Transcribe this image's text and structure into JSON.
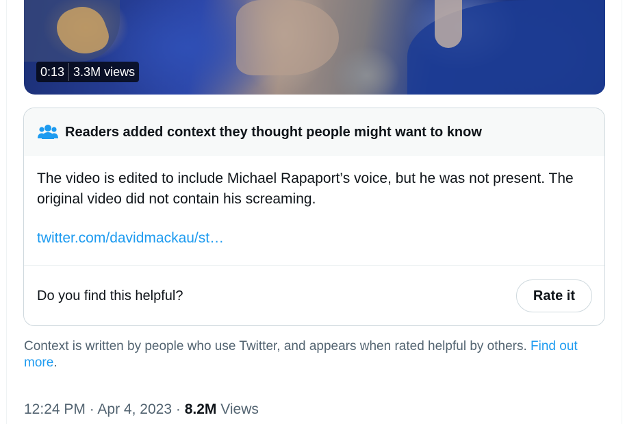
{
  "video": {
    "duration": "0:13",
    "views": "3.3M views"
  },
  "note": {
    "icon": "people-icon",
    "header": "Readers added context they thought people might want to know",
    "text": "The video is edited to include Michael Rapaport’s voice, but he was not present. The original video did not contain his screaming.",
    "link": "twitter.com/davidmackau/st…",
    "helpful_question": "Do you find this helpful?",
    "rate_button": "Rate it"
  },
  "context": {
    "text": "Context is written by people who use Twitter, and appears when rated helpful by others.",
    "link": "Find out more",
    "period": "."
  },
  "meta": {
    "time": "12:24 PM",
    "separator": "·",
    "date": "Apr 4, 2023",
    "views_count": "8.2M",
    "views_label": "Views"
  },
  "colors": {
    "accent": "#1d9bf0",
    "secondary_text": "#536471",
    "primary_text": "#0f1419"
  }
}
